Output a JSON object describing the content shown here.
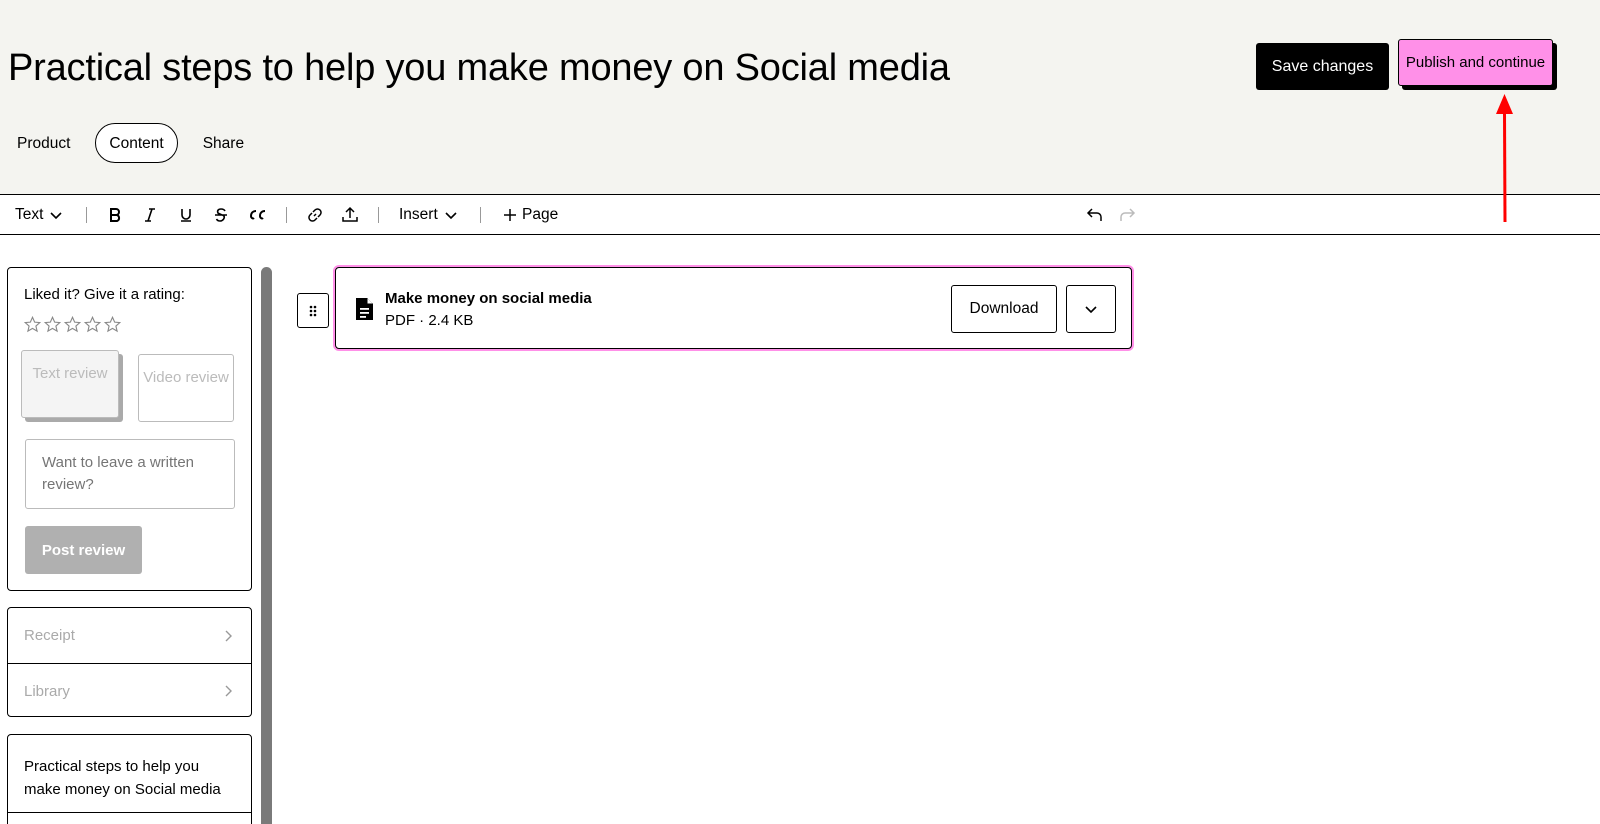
{
  "header": {
    "title": "Practical steps to help you make money on Social media",
    "save_label": "Save changes",
    "publish_label": "Publish and continue",
    "tabs": [
      {
        "label": "Product"
      },
      {
        "label": "Content"
      },
      {
        "label": "Share"
      }
    ]
  },
  "toolbar": {
    "text_style": "Text",
    "insert_label": "Insert",
    "page_label": "Page"
  },
  "sidebar": {
    "rating_label": "Liked it? Give it a rating:",
    "text_review_label": "Text review",
    "video_review_label": "Video review",
    "review_placeholder": "Want to leave a written review?",
    "post_review_label": "Post review",
    "links": [
      {
        "label": "Receipt"
      },
      {
        "label": "Library"
      }
    ],
    "toc_title": "Practical steps to help you make money on Social media"
  },
  "file": {
    "name": "Make money on social media",
    "meta": "PDF · 2.4 KB",
    "download_label": "Download"
  },
  "colors": {
    "accent_pink": "#ff90e8",
    "annotation_red": "#ff0000"
  }
}
